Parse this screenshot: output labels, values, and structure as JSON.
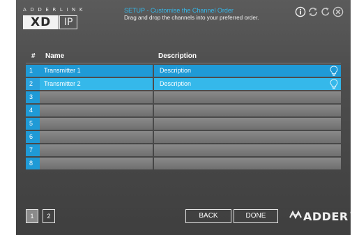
{
  "brand": {
    "top_text": "ADDERLINK",
    "logo_xd": "XD",
    "logo_ip": "IP"
  },
  "header": {
    "title": "SETUP - Customise the Channel Order",
    "subtitle": "Drag and drop the channels into your preferred order.",
    "icons": [
      "info-icon",
      "refresh-icon",
      "reset-icon",
      "close-icon"
    ]
  },
  "table": {
    "columns": [
      "#",
      "Name",
      "Description"
    ],
    "rows": [
      {
        "num": "1",
        "name": "Transmitter 1",
        "description": "Description",
        "active": true,
        "hint_icon": "lightbulb-icon"
      },
      {
        "num": "2",
        "name": "Transmitter 2",
        "description": "Description",
        "active": true,
        "hint_icon": "lightbulb-icon"
      },
      {
        "num": "3",
        "name": "",
        "description": "",
        "active": false
      },
      {
        "num": "4",
        "name": "",
        "description": "",
        "active": false
      },
      {
        "num": "5",
        "name": "",
        "description": "",
        "active": false
      },
      {
        "num": "6",
        "name": "",
        "description": "",
        "active": false
      },
      {
        "num": "7",
        "name": "",
        "description": "",
        "active": false
      },
      {
        "num": "8",
        "name": "",
        "description": "",
        "active": false
      }
    ]
  },
  "footer": {
    "pages": [
      "1",
      "2"
    ],
    "selected_page": "1",
    "back_label": "BACK",
    "done_label": "DONE",
    "logo_text": "ADDER",
    "logo_reg": "®"
  },
  "colors": {
    "accent": "#35b8ea",
    "accent_dark": "#1f9ad6",
    "panel": "#4e4e4e"
  }
}
